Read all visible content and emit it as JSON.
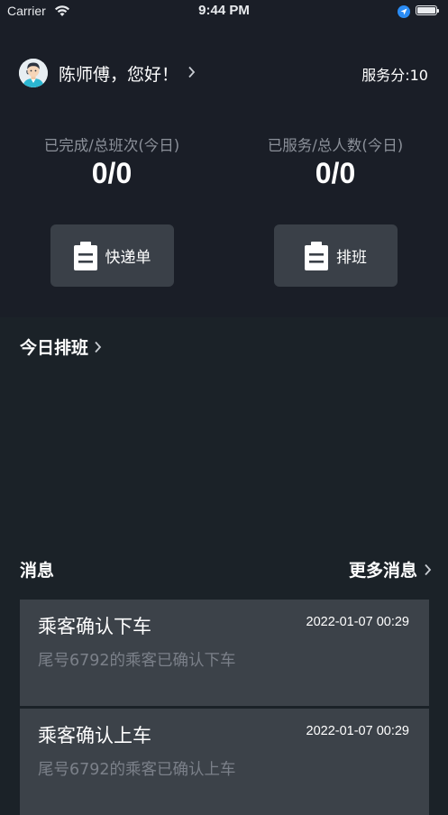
{
  "status_bar": {
    "carrier": "Carrier",
    "time": "9:44 PM"
  },
  "header": {
    "greeting": "陈师傅，您好！",
    "service_score": "服务分:10"
  },
  "stats": [
    {
      "label": "已完成/总班次(今日)",
      "value": "0/0"
    },
    {
      "label": "已服务/总人数(今日)",
      "value": "0/0"
    }
  ],
  "actions": [
    {
      "label": "快递单"
    },
    {
      "label": "排班"
    }
  ],
  "schedule": {
    "title": "今日排班"
  },
  "messages": {
    "title": "消息",
    "more": "更多消息",
    "items": [
      {
        "title": "乘客确认下车",
        "time": "2022-01-07 00:29",
        "desc": "尾号6792的乘客已确认下车"
      },
      {
        "title": "乘客确认上车",
        "time": "2022-01-07 00:29",
        "desc": "尾号6792的乘客已确认上车"
      }
    ]
  },
  "colors": {
    "top_panel_bg": "#1a1e27",
    "body_bg": "#1b2228",
    "button_bg": "#3a4048",
    "card_bg": "#3c4249",
    "muted_text": "#8b9099",
    "location_blue": "#2a8cf5"
  }
}
